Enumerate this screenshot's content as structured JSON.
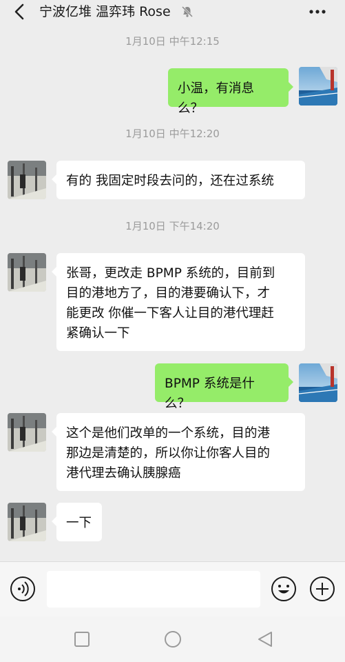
{
  "header": {
    "title": "宁波亿堆 温弈玮 Rose",
    "icons": [
      "back-arrow-icon",
      "mute-bell-icon",
      "more-icon"
    ]
  },
  "messages": [
    {
      "type": "timestamp",
      "text": "1月10日 中午12:15"
    },
    {
      "type": "message",
      "from": "me",
      "text": "小温，有消息么？"
    },
    {
      "type": "timestamp",
      "text": "1月10日 中午12:20"
    },
    {
      "type": "message",
      "from": "contact",
      "text": "有的 我固定时段去问的，还在过系统"
    },
    {
      "type": "timestamp",
      "text": "1月10日 下午14:20"
    },
    {
      "type": "message",
      "from": "contact",
      "lines": [
        "张哥，更改走 BPMP 系统的，目前到",
        "目的港地方了，目的港要确认下，才",
        "能更改 你催一下客人让目的港代理赶",
        "紧确认一下"
      ]
    },
    {
      "type": "message",
      "from": "me",
      "text": "BPMP 系统是什么？"
    },
    {
      "type": "message",
      "from": "contact",
      "lines": [
        "这个是他们改单的一个系统，目的港",
        "那边是清楚的，所以你让你客人目的",
        "港代理去确认胰腺癌"
      ]
    },
    {
      "type": "message",
      "from": "contact",
      "text": "一下"
    }
  ],
  "input_bar": {
    "text": "",
    "icons": [
      "voice-icon",
      "emoji-icon",
      "plus-icon"
    ]
  },
  "nav_bar": {
    "icons": [
      "recents-square-icon",
      "home-circle-icon",
      "back-triangle-icon"
    ]
  },
  "colors": {
    "background": "#ededed",
    "outgoing_bubble": "#95ec69",
    "incoming_bubble": "#ffffff",
    "timestamp_text": "#9b9b9b"
  }
}
